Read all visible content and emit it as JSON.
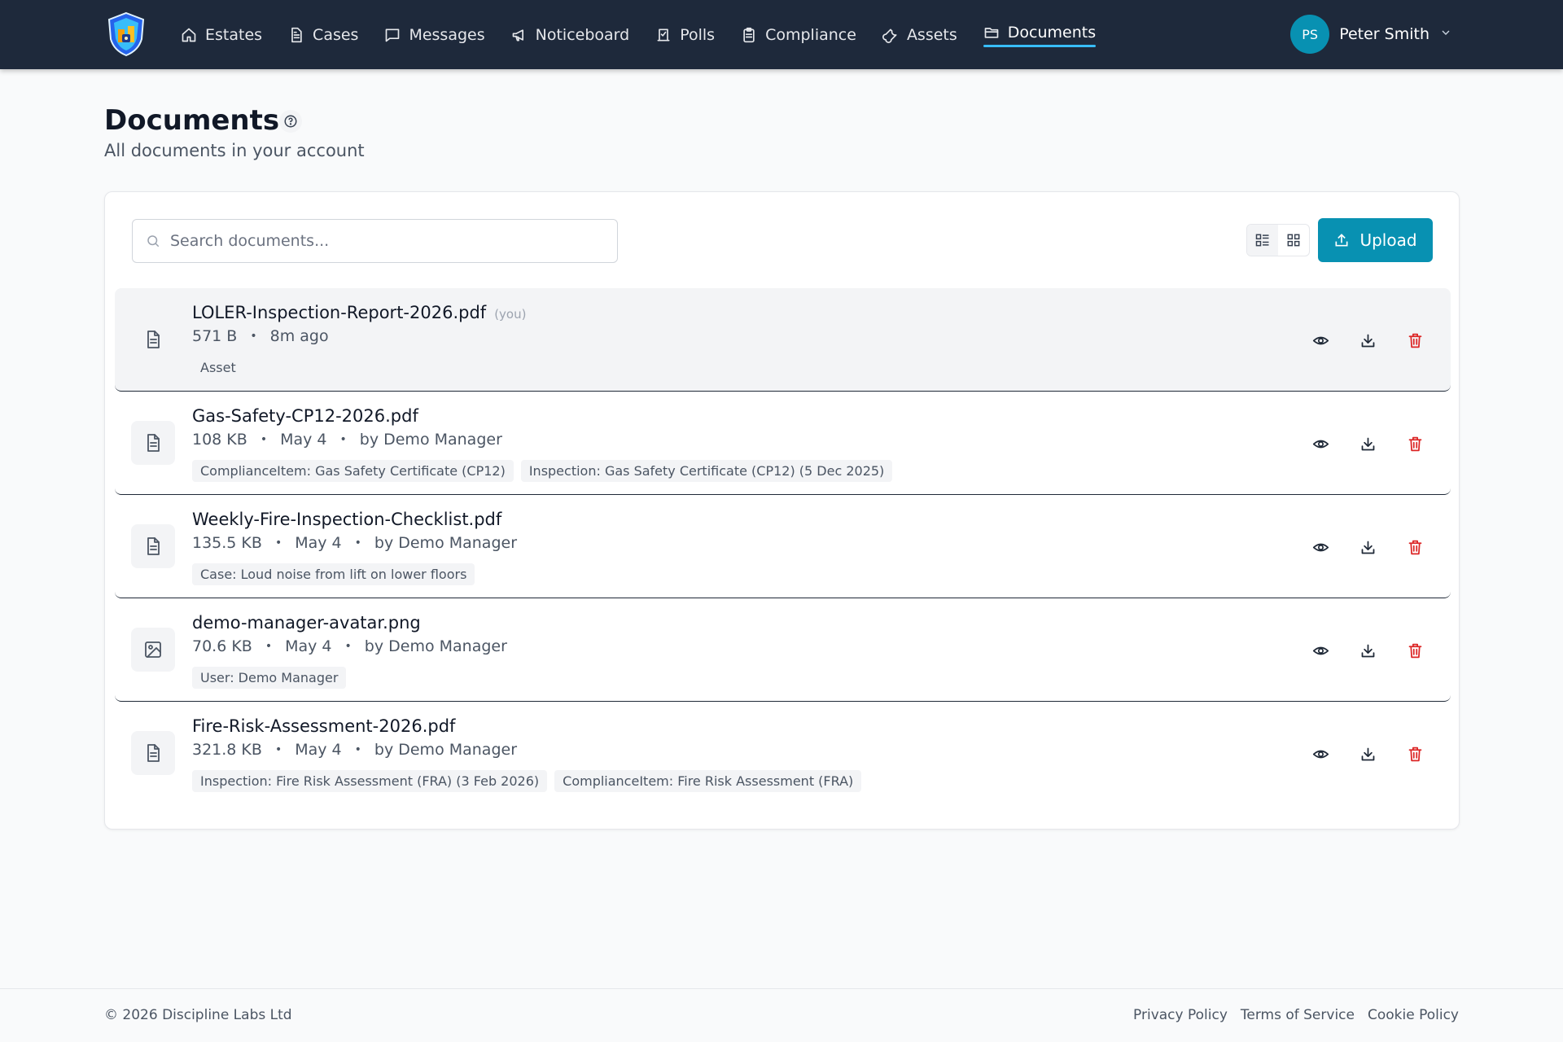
{
  "nav": {
    "items": [
      {
        "label": "Estates",
        "icon": "home-icon"
      },
      {
        "label": "Cases",
        "icon": "file-icon"
      },
      {
        "label": "Messages",
        "icon": "message-icon"
      },
      {
        "label": "Noticeboard",
        "icon": "megaphone-icon"
      },
      {
        "label": "Polls",
        "icon": "poll-icon"
      },
      {
        "label": "Compliance",
        "icon": "clipboard-icon"
      },
      {
        "label": "Assets",
        "icon": "wrench-icon"
      },
      {
        "label": "Documents",
        "icon": "folder-icon",
        "active": true
      }
    ],
    "user": {
      "initials": "PS",
      "name": "Peter Smith"
    }
  },
  "header": {
    "title": "Documents",
    "subtitle": "All documents in your account"
  },
  "toolbar": {
    "search_placeholder": "Search documents...",
    "upload_label": "Upload"
  },
  "documents": [
    {
      "name": "LOLER-Inspection-Report-2026.pdf",
      "you": "(you)",
      "size": "571 B",
      "date": "8m ago",
      "by": "",
      "tags": [
        "Asset"
      ],
      "type": "document"
    },
    {
      "name": "Gas-Safety-CP12-2026.pdf",
      "you": "",
      "size": "108 KB",
      "date": "May 4",
      "by": "by Demo Manager",
      "tags": [
        "ComplianceItem: Gas Safety Certificate (CP12)",
        "Inspection: Gas Safety Certificate (CP12) (5 Dec 2025)"
      ],
      "type": "document"
    },
    {
      "name": "Weekly-Fire-Inspection-Checklist.pdf",
      "you": "",
      "size": "135.5 KB",
      "date": "May 4",
      "by": "by Demo Manager",
      "tags": [
        "Case: Loud noise from lift on lower floors"
      ],
      "type": "document"
    },
    {
      "name": "demo-manager-avatar.png",
      "you": "",
      "size": "70.6 KB",
      "date": "May 4",
      "by": "by Demo Manager",
      "tags": [
        "User: Demo Manager"
      ],
      "type": "image"
    },
    {
      "name": "Fire-Risk-Assessment-2026.pdf",
      "you": "",
      "size": "321.8 KB",
      "date": "May 4",
      "by": "by Demo Manager",
      "tags": [
        "Inspection: Fire Risk Assessment (FRA) (3 Feb 2026)",
        "ComplianceItem: Fire Risk Assessment (FRA)"
      ],
      "type": "document"
    }
  ],
  "footer": {
    "copyright": "© 2026 Discipline Labs Ltd",
    "links": [
      "Privacy Policy",
      "Terms of Service",
      "Cookie Policy"
    ]
  },
  "colors": {
    "nav_bg": "#1e293b",
    "accent": "#0891b2",
    "danger": "#dc2626"
  }
}
